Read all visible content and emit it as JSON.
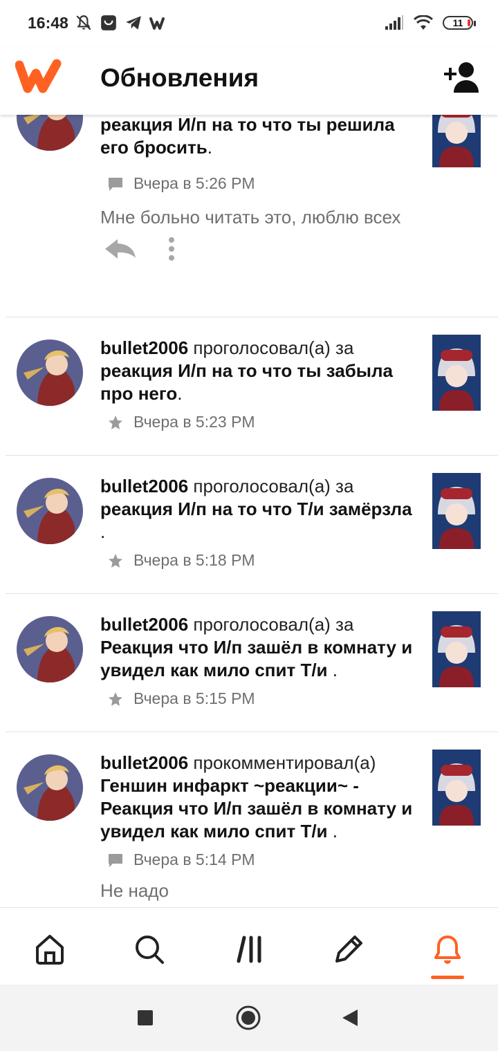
{
  "status_bar": {
    "time": "16:48",
    "battery": "11"
  },
  "header": {
    "title": "Обновления"
  },
  "colors": {
    "accent": "#ff6122",
    "text": "#121212",
    "muted": "#6f6f6f"
  },
  "feed": [
    {
      "story_title": "реакция И/п на то что ты решила его бросить",
      "trailing": ".",
      "time": "Вчера в 5:26 PM",
      "icon": "comment-icon",
      "comment": "Мне больно читать это, люблю всех"
    },
    {
      "user": "bullet2006",
      "action": "проголосовал(а) за",
      "story_title": "реакция И/п на то что ты забыла про него",
      "trailing": ".",
      "time": "Вчера в 5:23 PM",
      "icon": "star-icon"
    },
    {
      "user": "bullet2006",
      "action": "проголосовал(а) за",
      "story_title": "реакция И/п на то что Т/и замёрзла",
      "trailing": " .",
      "time": "Вчера в 5:18 PM",
      "icon": "star-icon"
    },
    {
      "user": "bullet2006",
      "action": "проголосовал(а) за",
      "story_title": "Реакция что И/п зашёл в комнату и увидел как мило спит Т/и",
      "trailing": " .",
      "time": "Вчера в 5:15 PM",
      "icon": "star-icon"
    },
    {
      "user": "bullet2006",
      "action": "прокомментировал(а)",
      "story_title": "Геншин инфаркт ~реакции~ - Реакция что И/п зашёл в комнату и увидел как мило спит Т/и",
      "trailing": " .",
      "time": "Вчера в 5:14 PM",
      "icon": "comment-icon",
      "comment": "Не надо"
    }
  ],
  "bottom_nav": [
    {
      "name": "home",
      "icon": "home-icon"
    },
    {
      "name": "search",
      "icon": "search-icon"
    },
    {
      "name": "library",
      "icon": "library-icon"
    },
    {
      "name": "write",
      "icon": "pencil-icon"
    },
    {
      "name": "notifications",
      "icon": "bell-icon",
      "active": true
    }
  ]
}
